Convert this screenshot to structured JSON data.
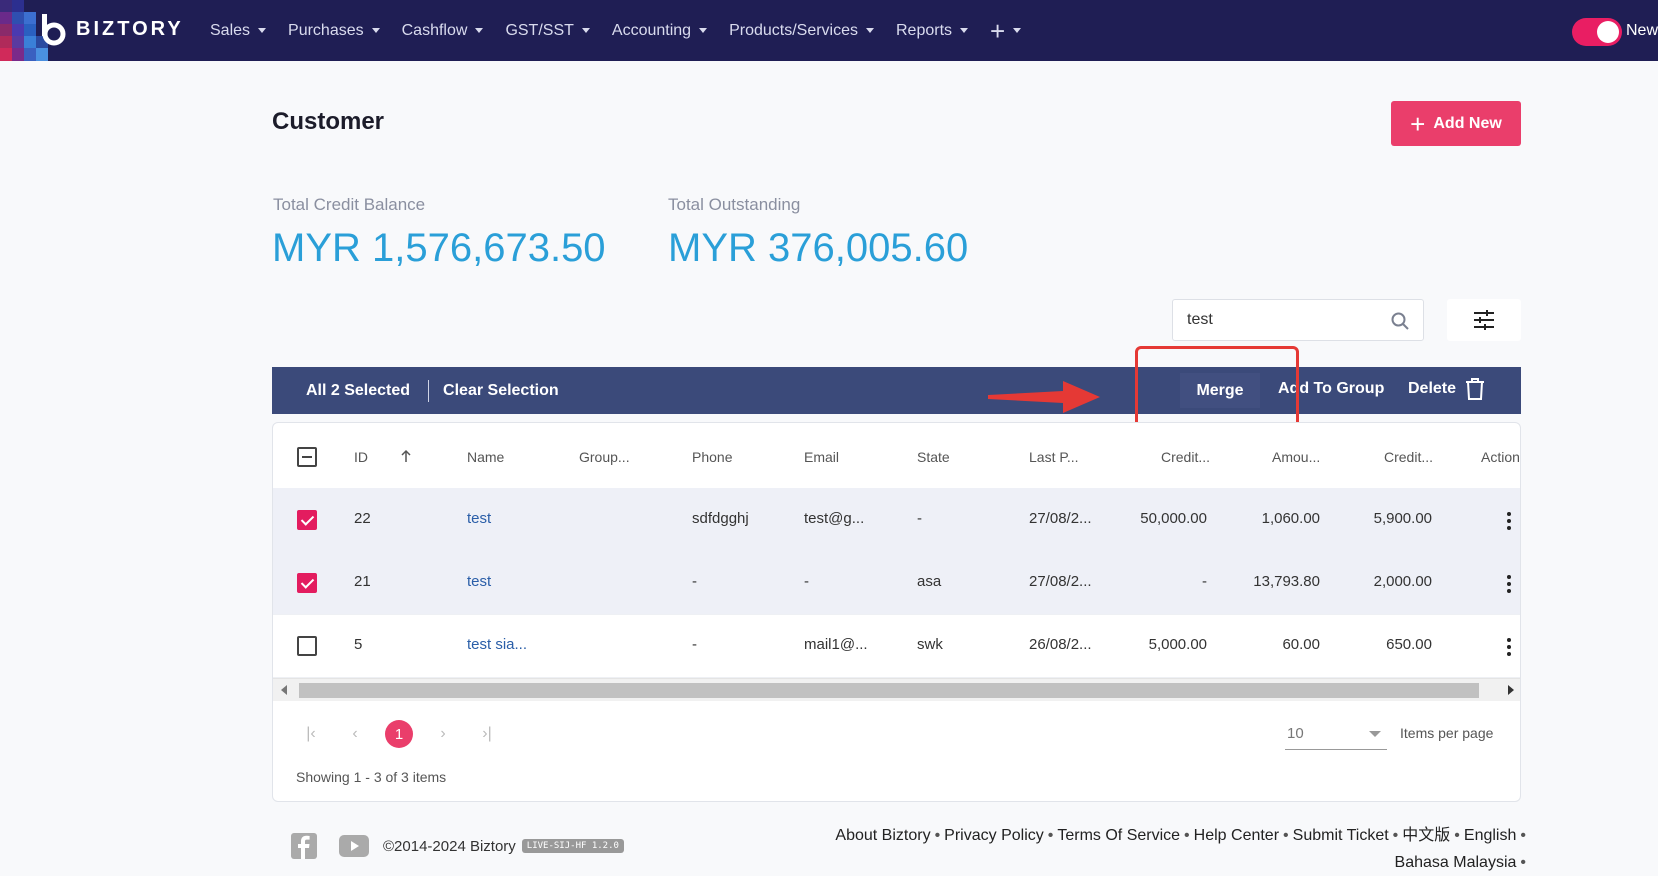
{
  "brand": {
    "name": "BIZTORY"
  },
  "nav": {
    "items": [
      {
        "label": "Sales"
      },
      {
        "label": "Purchases"
      },
      {
        "label": "Cashflow"
      },
      {
        "label": "GST/SST"
      },
      {
        "label": "Accounting"
      },
      {
        "label": "Products/Services"
      },
      {
        "label": "Reports"
      }
    ],
    "plus": "+",
    "toggle_label": "New"
  },
  "page": {
    "title": "Customer",
    "add_new_label": "Add New"
  },
  "stats": {
    "credit_balance": {
      "label": "Total Credit Balance",
      "value": "MYR 1,576,673.50"
    },
    "outstanding": {
      "label": "Total Outstanding",
      "value": "MYR 376,005.60"
    }
  },
  "search": {
    "value": "test"
  },
  "selection_bar": {
    "selected_text": "All 2 Selected",
    "clear_label": "Clear Selection",
    "merge_label": "Merge",
    "add_to_group_label": "Add To Group",
    "delete_label": "Delete"
  },
  "table": {
    "columns": [
      "ID",
      "Name",
      "Group...",
      "Phone",
      "Email",
      "State",
      "Last P...",
      "Credit...",
      "Amou...",
      "Credit...",
      "Action"
    ],
    "rows": [
      {
        "id": "22",
        "name": "test",
        "group": "",
        "phone": "sdfdgghj",
        "email": "test@g...",
        "state": "-",
        "last": "27/08/2...",
        "credit": "50,000.00",
        "amount": "1,060.00",
        "credit2": "5,900.00",
        "selected": true
      },
      {
        "id": "21",
        "name": "test",
        "group": "",
        "phone": "-",
        "email": "-",
        "state": "asa",
        "last": "27/08/2...",
        "credit": "-",
        "amount": "13,793.80",
        "credit2": "2,000.00",
        "selected": true
      },
      {
        "id": "5",
        "name": "test sia...",
        "group": "",
        "phone": "-",
        "email": "mail1@...",
        "state": "swk",
        "last": "26/08/2...",
        "credit": "5,000.00",
        "amount": "60.00",
        "credit2": "650.00",
        "selected": false
      }
    ]
  },
  "pagination": {
    "current_page": "1",
    "items_per_page": "10",
    "items_per_page_label": "Items per page",
    "showing": "Showing 1 - 3 of 3 items"
  },
  "footer": {
    "copyright": "©2014-2024 Biztory",
    "version": "LIVE-SIJ-HF 1.2.0",
    "links": [
      "About Biztory",
      "Privacy Policy",
      "Terms Of Service",
      "Help Center",
      "Submit Ticket",
      "中文版",
      "English",
      "Bahasa Malaysia"
    ]
  },
  "colors": {
    "nav_bg": "#1f1e54",
    "accent": "#ea3e6b",
    "value_blue": "#2a9fd8",
    "selection_bar": "#3b4a7a",
    "highlight": "#e53935"
  }
}
